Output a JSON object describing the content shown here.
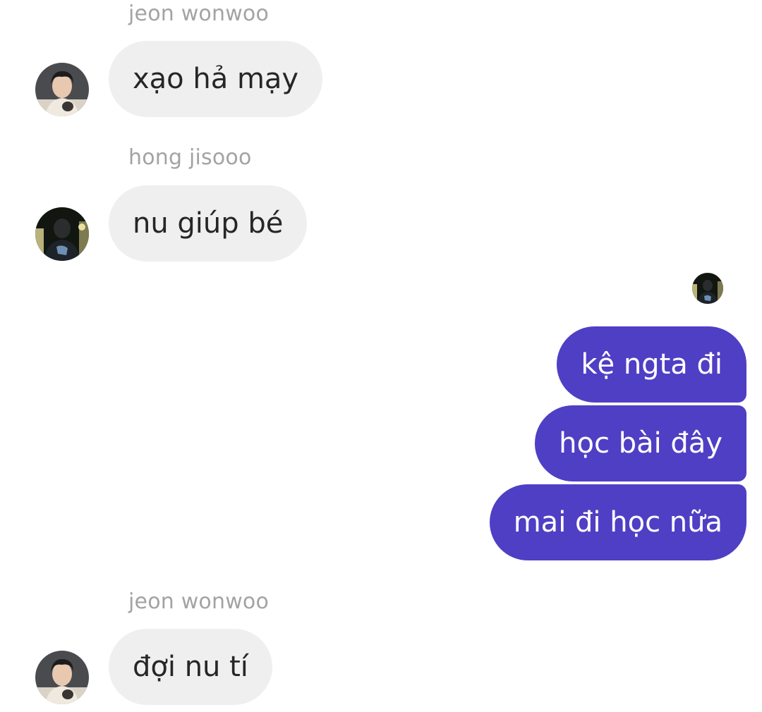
{
  "messages": [
    {
      "sender": "jeon wonwoo",
      "avatar_icon": "profile-photo-icon",
      "text": "xạo hả mạy"
    },
    {
      "sender": "hong jisooo",
      "avatar_icon": "profile-photo-icon",
      "text": "nu giúp bé"
    },
    {
      "sender": "",
      "outgoing": true,
      "text": "kệ ngta đi"
    },
    {
      "sender": "",
      "outgoing": true,
      "text": "học bài đây"
    },
    {
      "sender": "",
      "outgoing": true,
      "text": "mai đi học nữa"
    },
    {
      "sender": "jeon wonwoo",
      "avatar_icon": "profile-photo-icon",
      "text": "đợi nu tí"
    }
  ],
  "read_receipt_icon": "seen-avatar-icon",
  "colors": {
    "incoming_bubble": "#efefef",
    "incoming_text": "#262626",
    "outgoing_bubble": "#4f3fc4",
    "outgoing_text": "#ffffff",
    "sender_name": "#a3a3a3"
  }
}
